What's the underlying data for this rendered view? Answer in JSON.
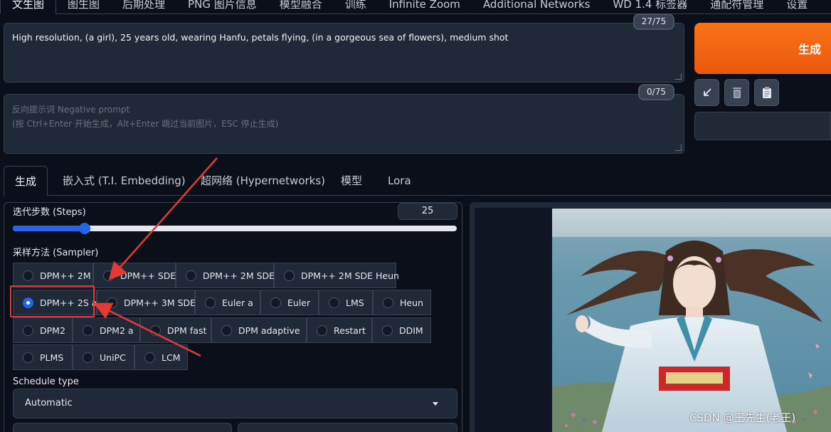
{
  "top_tabs": [
    "文生图",
    "图生图",
    "后期处理",
    "PNG 图片信息",
    "模型融合",
    "训练",
    "Infinite Zoom",
    "Additional Networks",
    "WD 1.4 标签器",
    "通配符管理",
    "设置"
  ],
  "prompt": {
    "text": "High resolution, (a girl), 25 years old, wearing Hanfu, petals flying, (in a gorgeous sea of flowers), medium shot",
    "counter": "27/75"
  },
  "negative_prompt": {
    "placeholder_line1": "反向提示词 Negative prompt",
    "placeholder_line2": "(按 Ctrl+Enter 开始生成，Alt+Enter 跳过当前图片，ESC 停止生成)",
    "counter": "0/75"
  },
  "generate_label": "生成",
  "sub_tabs": [
    "生成",
    "嵌入式 (T.I. Embedding)",
    "超网络 (Hypernetworks)",
    "模型",
    "Lora"
  ],
  "steps": {
    "label": "迭代步数 (Steps)",
    "value": "25",
    "min": 1,
    "max": 150
  },
  "sampler": {
    "label": "采样方法 (Sampler)",
    "selected": "DPM++ 2S a",
    "options": [
      "DPM++ 2M",
      "DPM++ SDE",
      "DPM++ 2M SDE",
      "DPM++ 2M SDE Heun",
      "DPM++ 2S a",
      "DPM++ 3M SDE",
      "Euler a",
      "Euler",
      "LMS",
      "Heun",
      "DPM2",
      "DPM2 a",
      "DPM fast",
      "DPM adaptive",
      "Restart",
      "DDIM",
      "PLMS",
      "UniPC",
      "LCM"
    ]
  },
  "schedule": {
    "label": "Schedule type",
    "value": "Automatic"
  },
  "watermark": "CSDN @王先生(老王)",
  "colors": {
    "accent": "#2563eb",
    "generate": "#f97316",
    "annotation": "#e53935"
  }
}
